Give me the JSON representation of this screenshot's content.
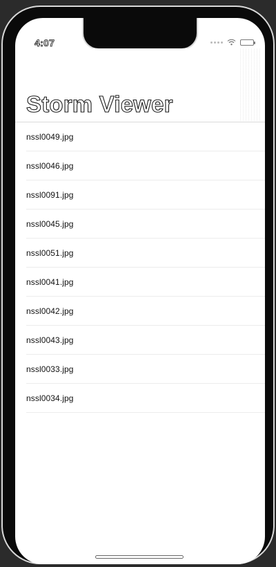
{
  "status_bar": {
    "time": "4:07"
  },
  "nav": {
    "title": "Storm Viewer"
  },
  "list": {
    "items": [
      "nssl0049.jpg",
      "nssl0046.jpg",
      "nssl0091.jpg",
      "nssl0045.jpg",
      "nssl0051.jpg",
      "nssl0041.jpg",
      "nssl0042.jpg",
      "nssl0043.jpg",
      "nssl0033.jpg",
      "nssl0034.jpg"
    ]
  },
  "icons": {
    "signal": "cellular-signal-icon",
    "wifi": "wifi-icon",
    "battery": "battery-icon"
  }
}
